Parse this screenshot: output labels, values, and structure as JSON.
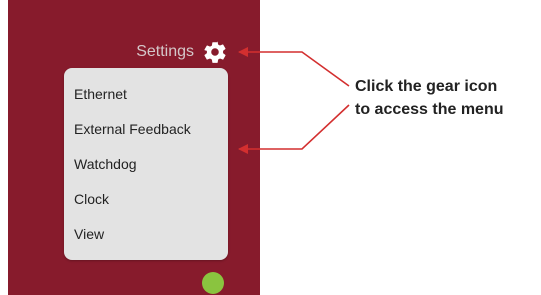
{
  "settings": {
    "label": "Settings",
    "icon": "gear-icon"
  },
  "menu": {
    "items": [
      {
        "label": "Ethernet"
      },
      {
        "label": "External Feedback"
      },
      {
        "label": "Watchdog"
      },
      {
        "label": "Clock"
      },
      {
        "label": "View"
      }
    ]
  },
  "status": {
    "icon": "status-dot-green",
    "color": "#8ac43f"
  },
  "callout": {
    "line1": "Click the gear icon",
    "line2": "to access the menu",
    "arrow_color": "#d32f2f"
  },
  "colors": {
    "panel": "#871b2c",
    "menu_bg": "#e3e3e3"
  }
}
